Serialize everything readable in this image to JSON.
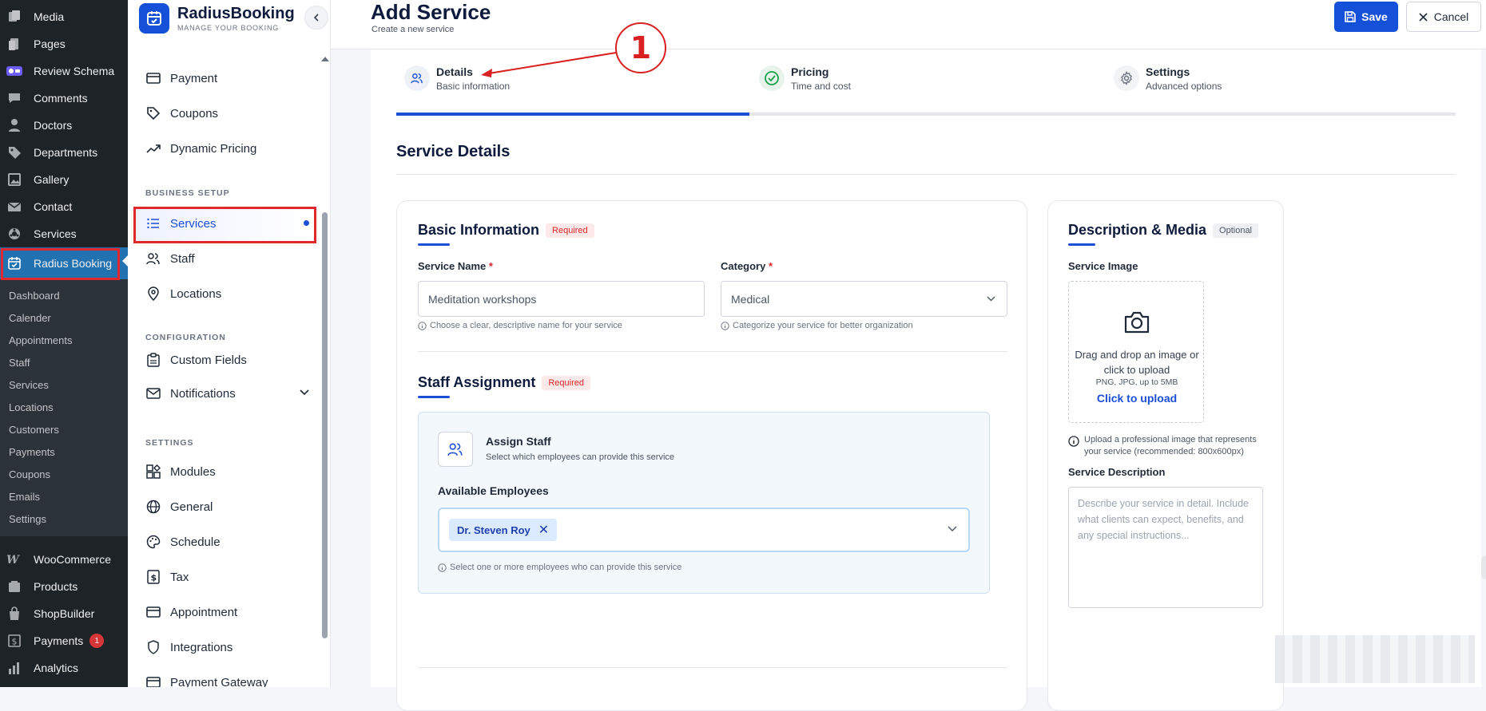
{
  "wp_menu": {
    "top_items": [
      {
        "label": "Media",
        "icon": "media-icon"
      },
      {
        "label": "Pages",
        "icon": "pages-icon"
      },
      {
        "label": "Review Schema",
        "icon": "review-schema-icon"
      },
      {
        "label": "Comments",
        "icon": "comments-icon"
      },
      {
        "label": "Doctors",
        "icon": "user-icon"
      },
      {
        "label": "Departments",
        "icon": "tag-icon"
      },
      {
        "label": "Gallery",
        "icon": "gallery-icon"
      },
      {
        "label": "Contact",
        "icon": "mail-icon"
      },
      {
        "label": "Services",
        "icon": "settings-wheel-icon"
      }
    ],
    "active_item": {
      "label": "Radius Booking",
      "icon": "calendar-icon"
    },
    "submenu": [
      "Dashboard",
      "Calender",
      "Appointments",
      "Staff",
      "Services",
      "Locations",
      "Customers",
      "Payments",
      "Coupons",
      "Emails",
      "Settings"
    ],
    "bottom_items": [
      {
        "label": "WooCommerce",
        "icon": "woocommerce-icon"
      },
      {
        "label": "Products",
        "icon": "products-icon"
      },
      {
        "label": "ShopBuilder",
        "icon": "shopbuilder-icon"
      },
      {
        "label": "Payments",
        "icon": "dollar-icon",
        "badge": "1"
      },
      {
        "label": "Analytics",
        "icon": "analytics-icon"
      }
    ]
  },
  "plugin_sidebar": {
    "brand_name": "RadiusBooking",
    "brand_tagline": "MANAGE YOUR BOOKING",
    "items_top": [
      {
        "label": "Payment",
        "icon": "card-icon"
      },
      {
        "label": "Coupons",
        "icon": "tag-icon"
      },
      {
        "label": "Dynamic Pricing",
        "icon": "trend-icon"
      }
    ],
    "section_business": "BUSINESS SETUP",
    "items_business": [
      {
        "label": "Services",
        "icon": "list-icon",
        "active": true
      },
      {
        "label": "Staff",
        "icon": "users-icon"
      },
      {
        "label": "Locations",
        "icon": "pin-icon"
      }
    ],
    "section_config": "CONFIGURATION",
    "items_config": [
      {
        "label": "Custom Fields",
        "icon": "clipboard-icon"
      },
      {
        "label": "Notifications",
        "icon": "mail-icon"
      }
    ],
    "section_settings": "SETTINGS",
    "items_settings": [
      {
        "label": "Modules",
        "icon": "modules-icon"
      },
      {
        "label": "General",
        "icon": "globe-icon"
      },
      {
        "label": "Schedule",
        "icon": "palette-icon"
      },
      {
        "label": "Tax",
        "icon": "dollar-icon"
      },
      {
        "label": "Appointment",
        "icon": "card-icon"
      },
      {
        "label": "Integrations",
        "icon": "shield-icon"
      },
      {
        "label": "Payment Gateway",
        "icon": "card-icon"
      }
    ]
  },
  "header": {
    "title": "Add Service",
    "subtitle": "Create a new service",
    "save_label": "Save",
    "cancel_label": "Cancel"
  },
  "steps": [
    {
      "title": "Details",
      "subtitle": "Basic information",
      "icon": "users-icon",
      "state": "active"
    },
    {
      "title": "Pricing",
      "subtitle": "Time and cost",
      "icon": "check-circle-icon",
      "state": "done"
    },
    {
      "title": "Settings",
      "subtitle": "Advanced options",
      "icon": "gear-icon",
      "state": "pending"
    }
  ],
  "step_progress": 0.333,
  "section_title": "Service Details",
  "basic_info": {
    "title": "Basic Information",
    "tag": "Required",
    "service_name_label": "Service Name",
    "service_name_value": "Meditation workshops",
    "service_name_hint": "Choose a clear, descriptive name for your service",
    "category_label": "Category",
    "category_value": "Medical",
    "category_hint": "Categorize your service for better organization",
    "required_mark": "*"
  },
  "staff": {
    "title": "Staff Assignment",
    "tag": "Required",
    "assign_title": "Assign Staff",
    "assign_sub": "Select which employees can provide this service",
    "available_label": "Available Employees",
    "selected_chip": "Dr. Steven Roy",
    "hint": "Select one or more employees who can provide this service"
  },
  "media": {
    "title": "Description & Media",
    "tag": "Optional",
    "image_label": "Service Image",
    "drop_line1": "Drag and drop an image or",
    "drop_line2": "click to upload",
    "formats": "PNG, JPG, up to 5MB",
    "upload_link": "Click to upload",
    "image_hint": "Upload a professional image that represents your service (recommended: 800x600px)",
    "desc_label": "Service Description",
    "desc_placeholder": "Describe your service in detail. Include what clients can expect, benefits, and any special instructions..."
  },
  "annotation_number": "1",
  "colors": {
    "primary": "#1450d8",
    "annotation": "#d92020",
    "wp_sidebar": "#1d2327",
    "wp_active": "#2271b1"
  }
}
